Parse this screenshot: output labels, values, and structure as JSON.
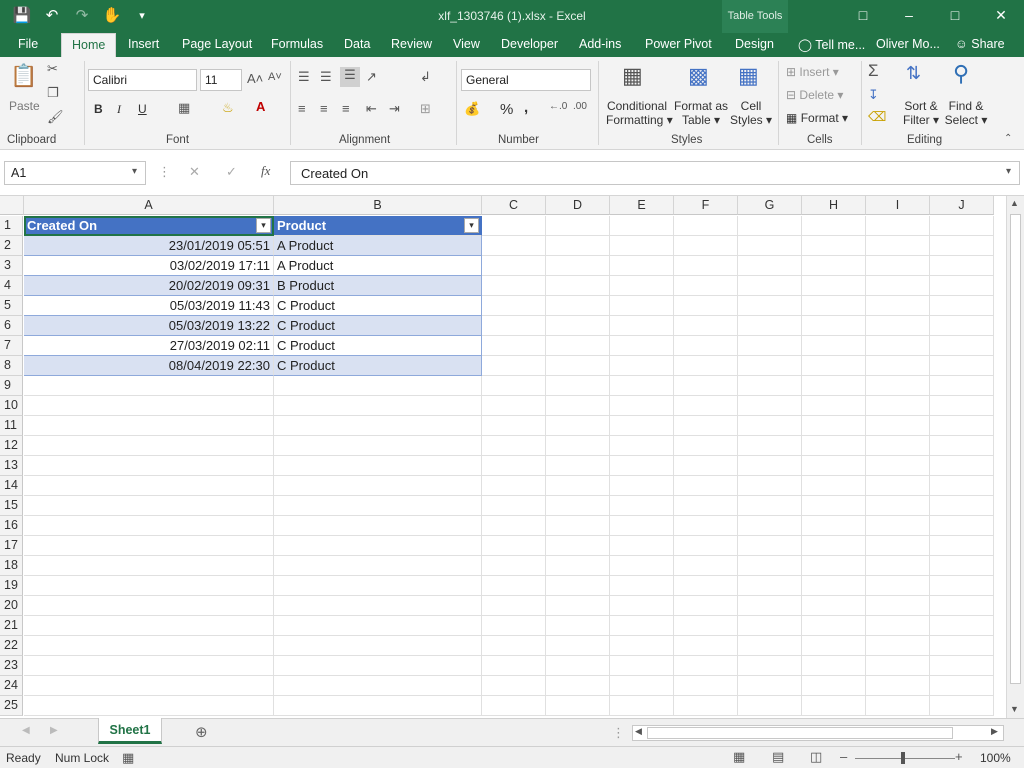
{
  "window": {
    "title": "xlf_1303746 (1).xlsx - Excel",
    "context_tab": "Table Tools"
  },
  "ribbon_tabs": [
    "File",
    "Home",
    "Insert",
    "Page Layout",
    "Formulas",
    "Data",
    "Review",
    "View",
    "Developer",
    "Add-ins",
    "Power Pivot",
    "Design"
  ],
  "active_tab": "Home",
  "tell_me": "Tell me...",
  "user": "Oliver Mo...",
  "share": "Share",
  "ribbon": {
    "clipboard": {
      "label": "Clipboard",
      "paste": "Paste"
    },
    "font": {
      "label": "Font",
      "name": "Calibri",
      "size": "11",
      "bold": "B",
      "italic": "I",
      "underline": "U"
    },
    "alignment": {
      "label": "Alignment"
    },
    "number": {
      "label": "Number",
      "format": "General",
      "percent": "%",
      "comma": ","
    },
    "styles": {
      "label": "Styles",
      "conditional_line1": "Conditional",
      "conditional_line2": "Formatting",
      "format_table_line1": "Format as",
      "format_table_line2": "Table",
      "cell_styles_line1": "Cell",
      "cell_styles_line2": "Styles"
    },
    "cells": {
      "label": "Cells",
      "insert": "Insert",
      "delete": "Delete",
      "format": "Format"
    },
    "editing": {
      "label": "Editing",
      "sort_line1": "Sort &",
      "sort_line2": "Filter",
      "find_line1": "Find &",
      "find_line2": "Select"
    }
  },
  "formula_bar": {
    "name_box": "A1",
    "content": "Created On"
  },
  "columns": [
    "A",
    "B",
    "C",
    "D",
    "E",
    "F",
    "G",
    "H",
    "I",
    "J"
  ],
  "rows": [
    "1",
    "2",
    "3",
    "4",
    "5",
    "6",
    "7",
    "8",
    "9",
    "10",
    "11",
    "12",
    "13",
    "14",
    "15",
    "16",
    "17",
    "18",
    "19",
    "20",
    "21",
    "22",
    "23",
    "24",
    "25"
  ],
  "table": {
    "headers": [
      "Created On",
      "Product"
    ],
    "rows": [
      [
        "23/01/2019 05:51",
        "A Product"
      ],
      [
        "03/02/2019 17:11",
        "A Product"
      ],
      [
        "20/02/2019 09:31",
        "B Product"
      ],
      [
        "05/03/2019 11:43",
        "C Product"
      ],
      [
        "05/03/2019 13:22",
        "C Product"
      ],
      [
        "27/03/2019 02:11",
        "C Product"
      ],
      [
        "08/04/2019 22:30",
        "C Product"
      ]
    ]
  },
  "sheet_tab": "Sheet1",
  "status": {
    "ready": "Ready",
    "num_lock": "Num Lock",
    "zoom": "100%"
  },
  "colors": {
    "accent": "#217346",
    "table_header": "#4472c4",
    "band": "#d9e1f2"
  }
}
